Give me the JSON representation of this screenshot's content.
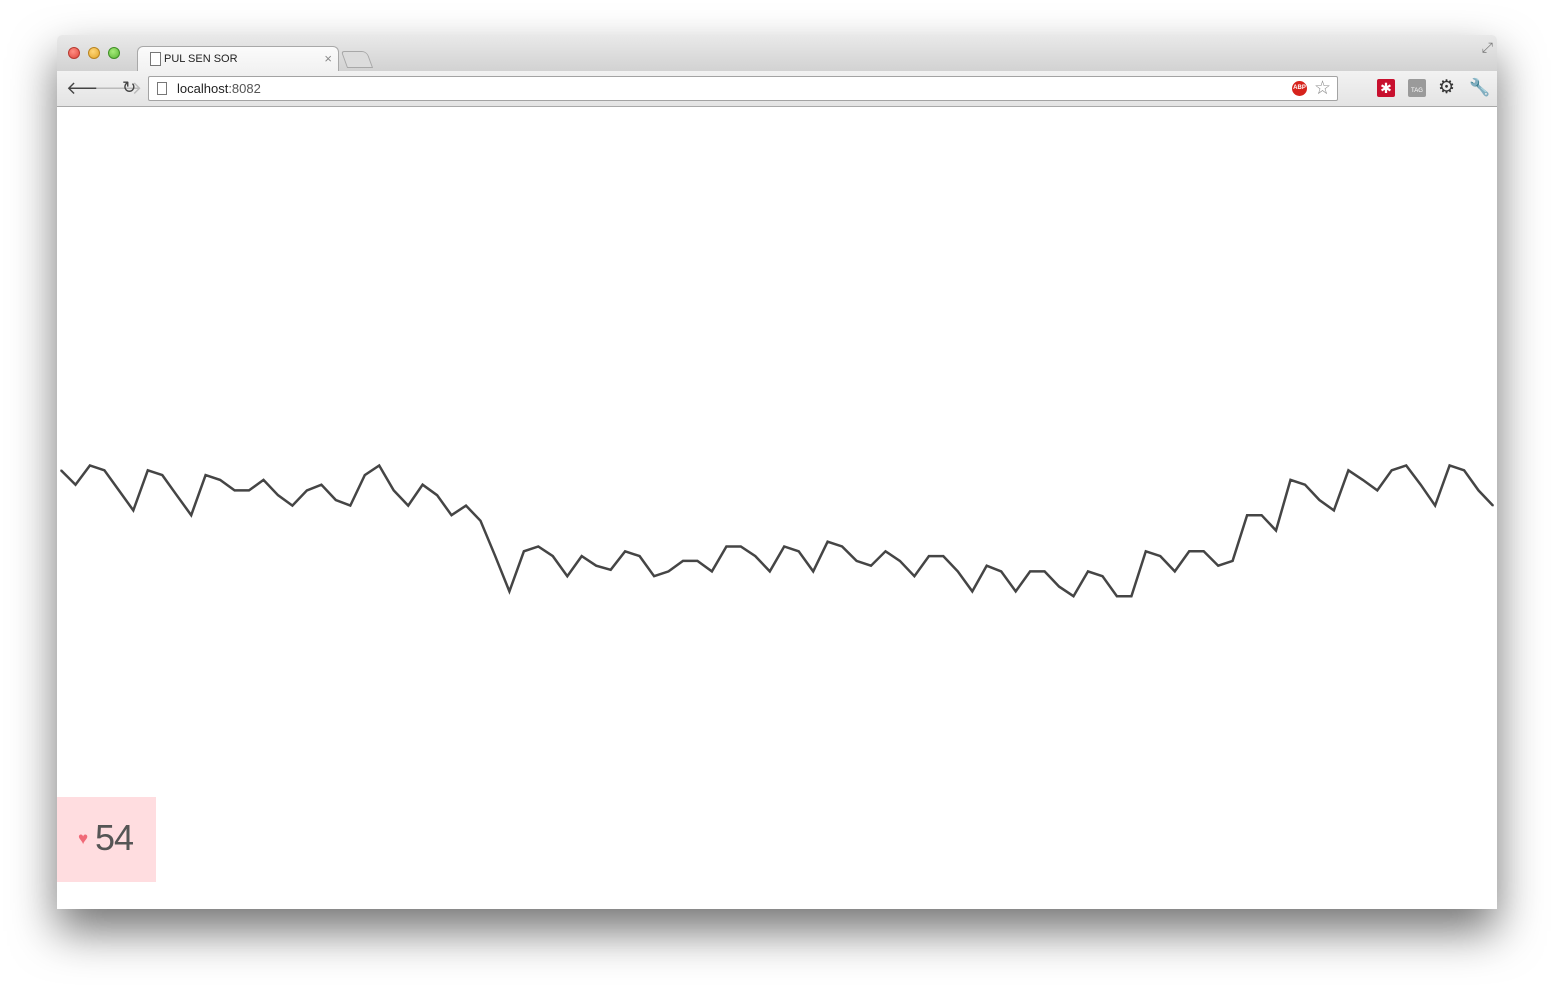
{
  "browser": {
    "tab_title": "PUL SEN SOR",
    "tab_close": "×",
    "url_host": "localhost",
    "url_port": ":8082",
    "abp_label": "ABP",
    "lastpass_glyph": "✱",
    "tag_label": "TAG"
  },
  "icons": {
    "back": "arrow-left",
    "forward": "arrow-right",
    "reload": "reload",
    "bookmark": "star",
    "settings": "gear",
    "extension": "wrench"
  },
  "pulse": {
    "heart_glyph": "♥",
    "bpm": "54",
    "badge_color": "#ffdde0",
    "heart_color": "#f06a78",
    "line_color": "#454545"
  },
  "chart_data": {
    "type": "line",
    "title": "",
    "xlabel": "",
    "ylabel": "",
    "ylim": [
      0,
      1
    ],
    "series": [
      {
        "values": [
          0.547,
          0.529,
          0.553,
          0.547,
          0.522,
          0.497,
          0.547,
          0.541,
          0.516,
          0.491,
          0.541,
          0.535,
          0.522,
          0.522,
          0.535,
          0.516,
          0.503,
          0.522,
          0.529,
          0.51,
          0.503,
          0.541,
          0.553,
          0.522,
          0.503,
          0.529,
          0.516,
          0.491,
          0.503,
          0.484,
          0.441,
          0.396,
          0.446,
          0.452,
          0.44,
          0.415,
          0.44,
          0.428,
          0.423,
          0.446,
          0.44,
          0.415,
          0.421,
          0.434,
          0.434,
          0.421,
          0.452,
          0.452,
          0.44,
          0.421,
          0.452,
          0.446,
          0.421,
          0.458,
          0.452,
          0.434,
          0.428,
          0.446,
          0.434,
          0.415,
          0.44,
          0.44,
          0.421,
          0.396,
          0.428,
          0.421,
          0.396,
          0.421,
          0.421,
          0.402,
          0.39,
          0.421,
          0.415,
          0.39,
          0.39,
          0.446,
          0.44,
          0.421,
          0.446,
          0.446,
          0.428,
          0.434,
          0.491,
          0.491,
          0.472,
          0.535,
          0.529,
          0.51,
          0.497,
          0.547,
          0.535,
          0.522,
          0.547,
          0.553,
          0.529,
          0.503,
          0.553,
          0.547,
          0.522,
          0.503
        ]
      }
    ],
    "grid": false,
    "legend": "none"
  }
}
